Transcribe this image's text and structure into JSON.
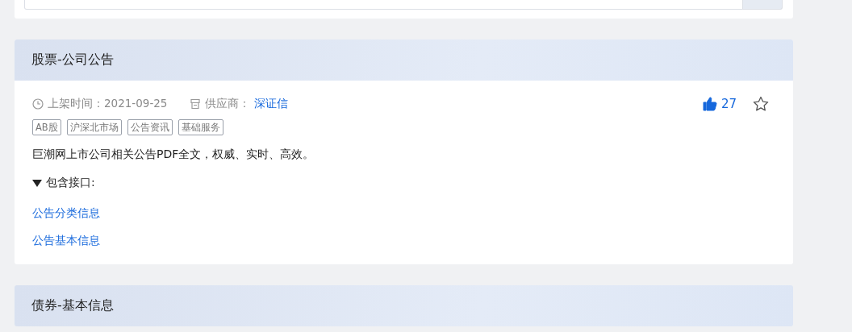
{
  "cards": [
    {
      "title": "股票-公司公告",
      "date_label": "上架时间：",
      "date": "2021-09-25",
      "supplier_label": "供应商：",
      "supplier": "深证信",
      "likes": "27",
      "liked": true,
      "favorited": false,
      "tags": [
        "AB股",
        "沪深北市场",
        "公告资讯",
        "基础服务"
      ],
      "description": "巨潮网上市公司相关公告PDF全文，权威、实时、高效。",
      "interfaces_label": "包含接口:",
      "expanded": true,
      "interfaces": [
        "公告分类信息",
        "公告基本信息"
      ]
    },
    {
      "title": "债券-基本信息"
    }
  ]
}
